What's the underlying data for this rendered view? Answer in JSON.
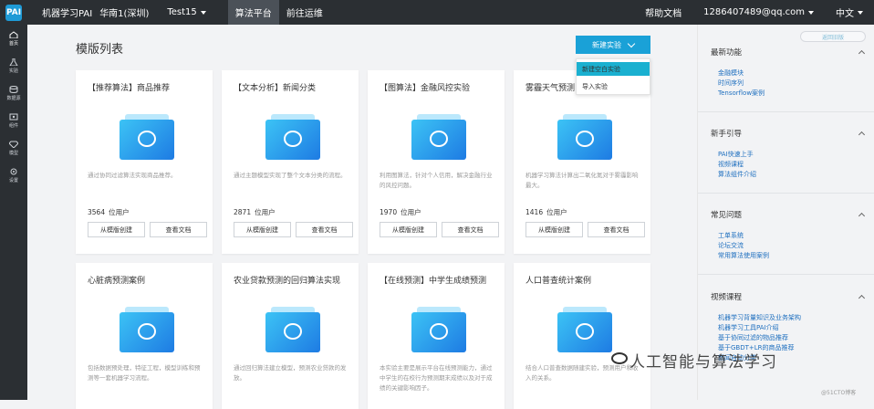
{
  "topbar": {
    "logo_text": "PAI",
    "app_title": "机器学习PAI",
    "region": "华南1(深圳)",
    "project": "Test15",
    "nav_tabs": [
      {
        "label": "算法平台"
      },
      {
        "label": "前往运维"
      }
    ],
    "help": "帮助文档",
    "account": "1286407489@qq.com",
    "language": "中文"
  },
  "sidenav": {
    "items": [
      {
        "label": "首页",
        "icon": "home-icon"
      },
      {
        "label": "实验",
        "icon": "flask-icon"
      },
      {
        "label": "数据源",
        "icon": "database-icon"
      },
      {
        "label": "组件",
        "icon": "puzzle-icon"
      },
      {
        "label": "模型",
        "icon": "diamond-icon"
      },
      {
        "label": "设置",
        "icon": "gear-icon"
      }
    ]
  },
  "main": {
    "title": "模版列表",
    "new_button": "新建实验",
    "dropdown": [
      "新建空白实验",
      "导入实验"
    ],
    "cards": [
      {
        "title": "【推荐算法】商品推荐",
        "desc": "通过协同过滤算法实现商品推荐。",
        "users": "3564",
        "unit": "位用户",
        "create": "从模版创建",
        "docs": "查看文档"
      },
      {
        "title": "【文本分析】新闻分类",
        "desc": "通过主题模型实现了整个文本分类的流程。",
        "users": "2871",
        "unit": "位用户",
        "create": "从模版创建",
        "docs": "查看文档"
      },
      {
        "title": "【图算法】金融风控实验",
        "desc": "利用图算法，针对个人信用，解决金融行业的风控问题。",
        "users": "1970",
        "unit": "位用户",
        "create": "从模版创建",
        "docs": "查看文档"
      },
      {
        "title": "雾霾天气预测",
        "desc": "机器学习算法计算出二氧化氮对于雾霾影响最大。",
        "users": "1416",
        "unit": "位用户",
        "create": "从模版创建",
        "docs": "查看文档"
      },
      {
        "title": "心脏病预测案例",
        "desc": "包括数据预处理，特征工程，模型训练和预测等一套机器学习流程。",
        "users": "",
        "unit": "",
        "create": "",
        "docs": ""
      },
      {
        "title": "农业贷款预测的回归算法实现",
        "desc": "通过回归算法建立模型，预测农业贷款的发放。",
        "users": "",
        "unit": "",
        "create": "",
        "docs": ""
      },
      {
        "title": "【在线预测】中学生成绩预测",
        "desc": "本实验主要是展示平台在线预测能力，通过中学生的在校行为预测期末成绩以及对于成绩的关键影响因子。",
        "users": "",
        "unit": "",
        "create": "",
        "docs": ""
      },
      {
        "title": "人口普查统计案例",
        "desc": "结合人口普查数据随建实验，预测用户和收入的关系。",
        "users": "",
        "unit": "",
        "create": "",
        "docs": ""
      }
    ]
  },
  "rightpanel": {
    "back_link": "返回旧版",
    "sections": [
      {
        "title": "最新功能",
        "links": [
          "金融模块",
          "时间序列",
          "Tensorflow案例"
        ]
      },
      {
        "title": "新手引导",
        "links": [
          "PAI快速上手",
          "视频课程",
          "算法组件介绍"
        ]
      },
      {
        "title": "常见问题",
        "links": [
          "工单系统",
          "论坛交流",
          "常用算法使用案例"
        ]
      },
      {
        "title": "视频课程",
        "links": [
          "机器学习背量知识及业务架构",
          "机器学习工具PAI介绍",
          "基于协同过滤的物品推荐",
          "基于GBDT+LR的商品推荐",
          "新闻自动分类"
        ]
      }
    ]
  },
  "watermark": "人工智能与算法学习",
  "credit": "@51CTO博客",
  "colors": {
    "topbar": "#2b2f33",
    "accent": "#1aa1d7",
    "link": "#1e6fbf"
  }
}
